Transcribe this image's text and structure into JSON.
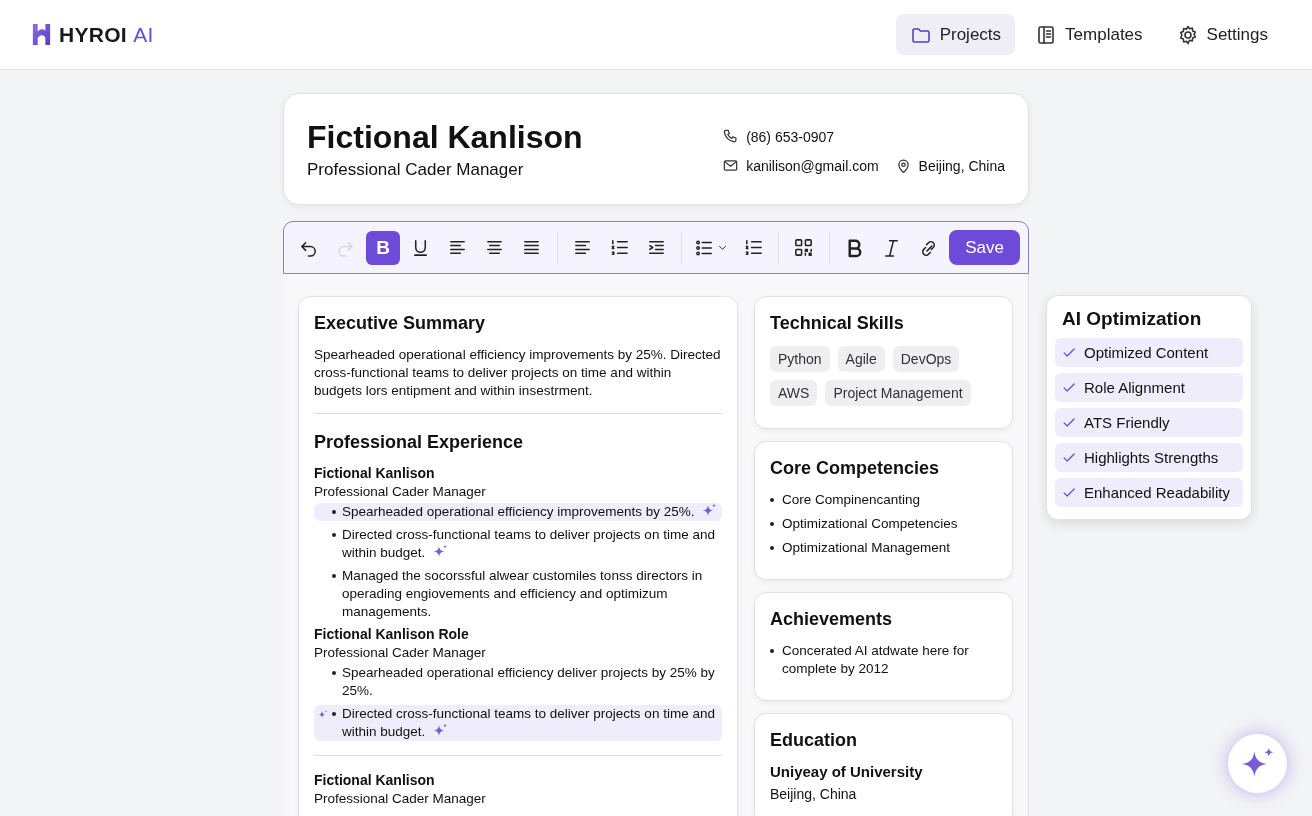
{
  "logo": {
    "name": "HYROI",
    "suffix": "AI"
  },
  "nav": [
    {
      "kind": "folder",
      "label": "Projects",
      "selected": true
    },
    {
      "kind": "template",
      "label": "Templates",
      "selected": false
    },
    {
      "kind": "gear",
      "label": "Settings",
      "selected": false
    }
  ],
  "profile": {
    "name": "Fictional Kanlison",
    "title": "Professional Cader Manager",
    "phone": "(86) 653-0907",
    "email": "kanilison@gmail.com",
    "location": "Beijing, China"
  },
  "toolbar": [
    {
      "kind": "undo",
      "disabled": false,
      "selected": false
    },
    {
      "kind": "redo",
      "disabled": true,
      "selected": false
    },
    {
      "kind": "letter",
      "label": "B",
      "disabled": false,
      "selected": true
    },
    {
      "kind": "underline",
      "disabled": false,
      "selected": false
    },
    {
      "kind": "align-left",
      "disabled": false,
      "selected": false
    },
    {
      "kind": "align-center",
      "disabled": false,
      "selected": false
    },
    {
      "kind": "justify",
      "disabled": false,
      "selected": false
    },
    {
      "kind": "separator"
    },
    {
      "kind": "align-left",
      "disabled": false,
      "selected": false
    },
    {
      "kind": "numbered",
      "disabled": false,
      "selected": false
    },
    {
      "kind": "indent",
      "disabled": false,
      "selected": false
    },
    {
      "kind": "separator"
    },
    {
      "kind": "bullets-menu",
      "disabled": false,
      "selected": false
    },
    {
      "kind": "numbered",
      "disabled": false,
      "selected": false
    },
    {
      "kind": "separator"
    },
    {
      "kind": "grid",
      "disabled": false,
      "selected": false
    },
    {
      "kind": "separator"
    },
    {
      "kind": "bold",
      "disabled": false,
      "selected": false
    },
    {
      "kind": "italic",
      "disabled": false,
      "selected": false
    },
    {
      "kind": "link",
      "disabled": false,
      "selected": false
    },
    {
      "kind": "save",
      "label": "Save"
    }
  ],
  "summary": {
    "title": "Executive Summary",
    "text": "Spearheaded operational efficiency improvements by 25%. Directed cross-functional teams to deliver projects on time and within budgets lors entipment and within insestrment."
  },
  "experience": {
    "title": "Professional Experience",
    "jobs": [
      {
        "name": "Fictional Kanlison",
        "role": "Professional Cader Manager",
        "divider_before": false,
        "bullets": [
          {
            "text": "Spearheaded operational efficiency improvements by 25%.",
            "highlighted": true,
            "sparkle_before": false,
            "sparkle_after": true
          },
          {
            "text": "Directed cross-functional teams to deliver projects on time and within budget.",
            "highlighted": false,
            "sparkle_before": false,
            "sparkle_after": true
          },
          {
            "text": "Managed the socorssful alwear customiles tonss directors in operading engiovements and efficiency and optimizum managements.",
            "highlighted": false,
            "sparkle_before": false,
            "sparkle_after": false
          }
        ]
      },
      {
        "name": "Fictional Kanlison Role",
        "role": "Professional Cader Manager",
        "divider_before": false,
        "bullets": [
          {
            "text": "Spearheaded operational efficiency deliver projects by 25% by 25%.",
            "highlighted": false,
            "sparkle_before": false,
            "sparkle_after": false
          },
          {
            "text": "Directed cross-functional teams to deliver projects on time and within budget.",
            "highlighted": true,
            "sparkle_before": true,
            "sparkle_after": true
          }
        ]
      },
      {
        "name": "Fictional Kanlison",
        "role": "Professional Cader Manager",
        "divider_before": true
      }
    ]
  },
  "side_cards": [
    {
      "kind": "tags",
      "title": "Technical Skills",
      "items": [
        "Python",
        "Agile",
        "DevOps",
        "AWS",
        "Project Management"
      ]
    },
    {
      "kind": "list",
      "title": "Core Competencies",
      "items": [
        "Core Compinencanting",
        "Optimizational Competencies",
        "Optimizational Management"
      ]
    },
    {
      "kind": "list",
      "title": "Achievements",
      "items": [
        "Concerated AI atdwate here for complete by 2012"
      ]
    },
    {
      "kind": "education",
      "title": "Education",
      "school": "Uniyeay of University",
      "place": "Beijing, China"
    }
  ],
  "ai_panel": {
    "title": "AI Optimization",
    "items": [
      {
        "label": "Optimized Content",
        "checked": true
      },
      {
        "label": "Role Alignment",
        "checked": true
      },
      {
        "label": "ATS Friendly",
        "checked": true
      },
      {
        "label": "Highlights Strengths",
        "checked": true
      },
      {
        "label": "Enhanced Readability",
        "checked": true
      }
    ]
  }
}
